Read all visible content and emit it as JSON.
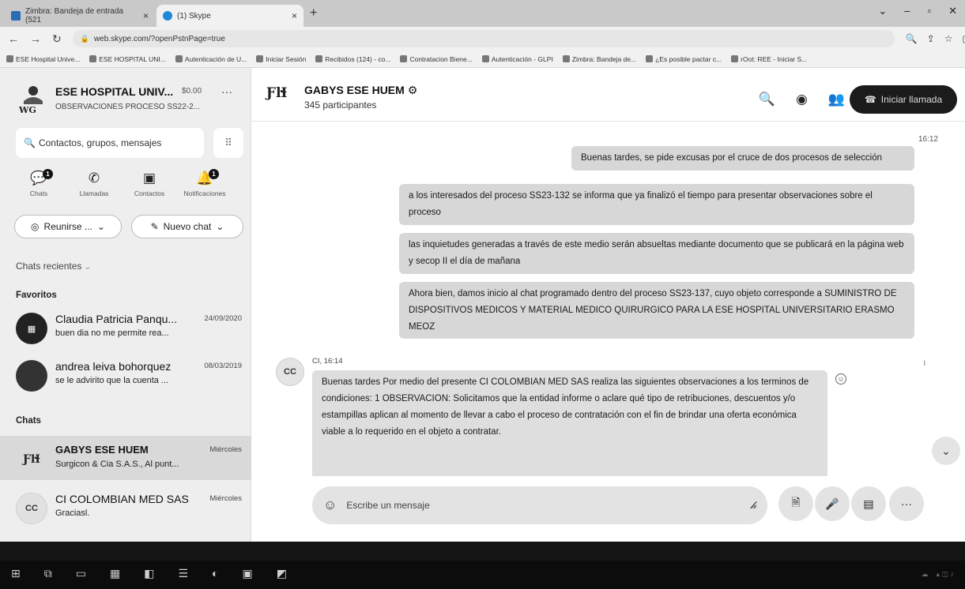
{
  "browser": {
    "tabs": [
      {
        "label": "Zimbra: Bandeja de entrada (521"
      },
      {
        "label": "(1) Skype"
      }
    ],
    "url": "web.skype.com/?openPstnPage=true",
    "bookmarks": [
      "ESE Hospital Unive...",
      "ESE HOSPITAL UNI...",
      "Autenticación de U...",
      "Iniciar Sesión",
      "Recibidos (124) - co...",
      "Contratacion Biene...",
      "Autenticación - GLPI",
      "Zimbra: Bandeja de...",
      "¿Es posible pactar c...",
      "rOot: REE - Iniciar S..."
    ]
  },
  "profile": {
    "name": "ESE HOSPITAL UNIV...",
    "credit": "$0.00",
    "mood": "OBSERVACIONES PROCESO SS22-2..."
  },
  "search": {
    "placeholder": "Contactos, grupos, mensajes"
  },
  "nav": [
    {
      "label": "Chats",
      "badge": "1"
    },
    {
      "label": "Llamadas"
    },
    {
      "label": "Contactos"
    },
    {
      "label": "Notificaciones",
      "badge": "1"
    }
  ],
  "buttons": {
    "meet": "Reunirse ...",
    "new_chat": "Nuevo chat"
  },
  "sections": {
    "recent": "Chats recientes",
    "favorites": "Favoritos",
    "chats": "Chats"
  },
  "favorites": [
    {
      "name": "Claudia Patricia Panqu...",
      "date": "24/09/2020",
      "preview": "buen dia no me permite rea..."
    },
    {
      "name": "andrea leiva bohorquez",
      "date": "08/03/2019",
      "preview": "se le advirito que la cuenta ..."
    }
  ],
  "chats": [
    {
      "name": "GABYS ESE HUEM",
      "date": "Miércoles",
      "preview": "Surgicon & Cia S.A.S., Al punt..."
    },
    {
      "name": "CI COLOMBIAN MED SAS",
      "date": "Miércoles",
      "preview": "Graciasl.",
      "initials": "CC"
    }
  ],
  "conversation": {
    "group_name": "GABYS ESE HUEM",
    "participants": "345 participantes",
    "call_label": "Iniciar llamada",
    "outgoing_time": "16:12",
    "outgoing": [
      "Buenas tardes, se pide excusas por el cruce de dos procesos de selección",
      "a los interesados del proceso SS23-132 se informa que ya finalizó el tiempo para presentar observaciones sobre el proceso",
      "las inquietudes generadas a través de este medio serán absueltas mediante documento que se publicará en la página web y secop II el día de mañana",
      "Ahora bien, damos inicio al chat programado dentro del proceso SS23-137, cuyo objeto corresponde a SUMINISTRO DE DISPOSITIVOS MEDICOS Y MATERIAL MEDICO QUIRURGICO PARA LA ESE HOSPITAL UNIVERSITARIO ERASMO MEOZ"
    ],
    "incoming": {
      "initials": "CC",
      "meta": "CI, 16:14",
      "text": "Buenas tardes Por medio del presente CI COLOMBIAN MED SAS realiza las siguientes observaciones a los terminos de condiciones: 1 OBSERVACION: Solicitamos que la entidad informe o aclare qué tipo de retribuciones, descuentos y/o estampillas aplican al momento de llevar a cabo el proceso de contratación con el fin de brindar una oferta económica viable a lo requerido en el objeto a contratar."
    },
    "composer_placeholder": "Escribe un mensaje"
  }
}
